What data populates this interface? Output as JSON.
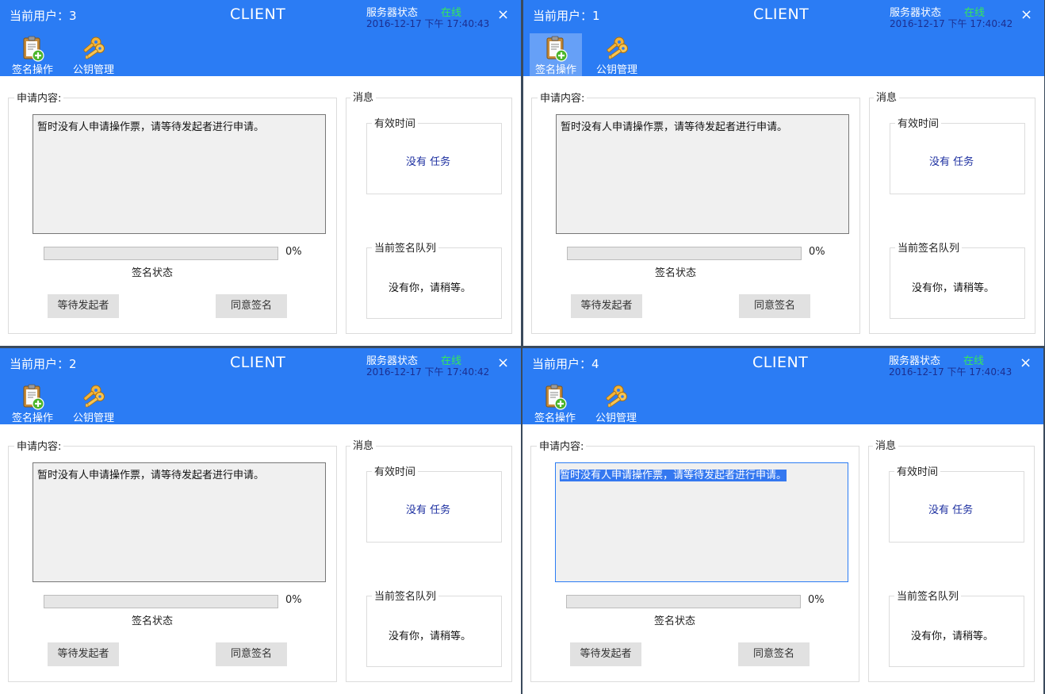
{
  "windows": [
    {
      "user_label": "当前用户：3",
      "title": "CLIENT",
      "server_status_label": "服务器状态",
      "server_status": "在线",
      "server_time": "2016-12-17 下午 17:40:43",
      "close_glyph": "×",
      "toolbar": [
        {
          "label": "签名操作",
          "icon": "clipboard-add-icon",
          "selected": false
        },
        {
          "label": "公钥管理",
          "icon": "keys-icon",
          "selected": false
        }
      ],
      "request_group_title": "申请内容:",
      "request_text": "暂时没有人申请操作票，请等待发起者进行申请。",
      "progress_percent": 0,
      "progress_text": "0%",
      "sign_state_label": "签名状态",
      "wait_button": "等待发起者",
      "agree_button": "同意签名",
      "message_group_title": "消息",
      "valid_time_title": "有效时间",
      "task_text": "没有  任务",
      "queue_title": "当前签名队列",
      "queue_text": "没有你，请稍等。"
    },
    {
      "user_label": "当前用户：1",
      "title": "CLIENT",
      "server_status_label": "服务器状态",
      "server_status": "在线",
      "server_time": "2016-12-17 下午 17:40:42",
      "close_glyph": "×",
      "toolbar": [
        {
          "label": "签名操作",
          "icon": "clipboard-add-icon",
          "selected": true
        },
        {
          "label": "公钥管理",
          "icon": "keys-icon",
          "selected": false
        }
      ],
      "request_group_title": "申请内容:",
      "request_text": "暂时没有人申请操作票，请等待发起者进行申请。",
      "progress_percent": 0,
      "progress_text": "0%",
      "sign_state_label": "签名状态",
      "wait_button": "等待发起者",
      "agree_button": "同意签名",
      "message_group_title": "消息",
      "valid_time_title": "有效时间",
      "task_text": "没有  任务",
      "queue_title": "当前签名队列",
      "queue_text": "没有你，请稍等。"
    },
    {
      "user_label": "当前用户：2",
      "title": "CLIENT",
      "server_status_label": "服务器状态",
      "server_status": "在线",
      "server_time": "2016-12-17 下午 17:40:42",
      "close_glyph": "×",
      "toolbar": [
        {
          "label": "签名操作",
          "icon": "clipboard-add-icon",
          "selected": false
        },
        {
          "label": "公钥管理",
          "icon": "keys-icon",
          "selected": false
        }
      ],
      "request_group_title": "申请内容:",
      "request_text": "暂时没有人申请操作票，请等待发起者进行申请。",
      "progress_percent": 0,
      "progress_text": "0%",
      "sign_state_label": "签名状态",
      "wait_button": "等待发起者",
      "agree_button": "同意签名",
      "message_group_title": "消息",
      "valid_time_title": "有效时间",
      "task_text": "没有  任务",
      "queue_title": "当前签名队列",
      "queue_text": "没有你，请稍等。"
    },
    {
      "user_label": "当前用户：4",
      "title": "CLIENT",
      "server_status_label": "服务器状态",
      "server_status": "在线",
      "server_time": "2016-12-17 下午 17:40:43",
      "close_glyph": "×",
      "toolbar": [
        {
          "label": "签名操作",
          "icon": "clipboard-add-icon",
          "selected": false
        },
        {
          "label": "公钥管理",
          "icon": "keys-icon",
          "selected": false
        }
      ],
      "request_group_title": "申请内容:",
      "request_text": "暂时没有人申请操作票，请等待发起者进行申请。",
      "request_text_selected": true,
      "progress_percent": 0,
      "progress_text": "0%",
      "sign_state_label": "签名状态",
      "wait_button": "等待发起者",
      "agree_button": "同意签名",
      "message_group_title": "消息",
      "valid_time_title": "有效时间",
      "task_text": "没有  任务",
      "queue_title": "当前签名队列",
      "queue_text": "没有你，请稍等。"
    }
  ],
  "colors": {
    "header_blue": "#2b7cf4",
    "online_green": "#35e85a",
    "time_navy": "#1c2f8f",
    "task_blue": "#1c2fa0"
  }
}
